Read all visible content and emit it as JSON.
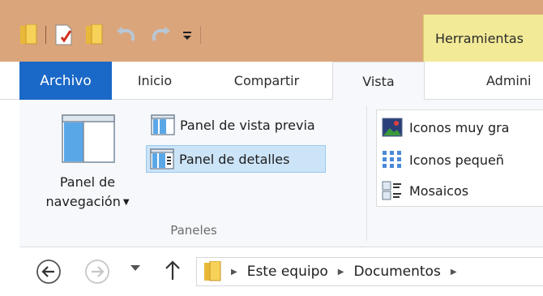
{
  "contextual_tab": {
    "label": "Herramientas"
  },
  "tabs": {
    "file": "Archivo",
    "home": "Inicio",
    "share": "Compartir",
    "view": "Vista",
    "admin": "Admini"
  },
  "ribbon": {
    "navigation_pane": {
      "line1": "Panel de",
      "line2": "navegación"
    },
    "preview_pane": "Panel de vista previa",
    "details_pane": "Panel de detalles",
    "group_label": "Paneles",
    "layout": {
      "extra_large": "Iconos muy gra",
      "small": "Iconos pequeñ",
      "tiles": "Mosaicos"
    }
  },
  "address": {
    "crumbs": [
      "Este equipo",
      "Documentos"
    ]
  },
  "colors": {
    "titlebar": "#dba57c",
    "file_tab": "#1a68c7",
    "contextual": "#f2ea96",
    "selected": "#cce4f7"
  }
}
